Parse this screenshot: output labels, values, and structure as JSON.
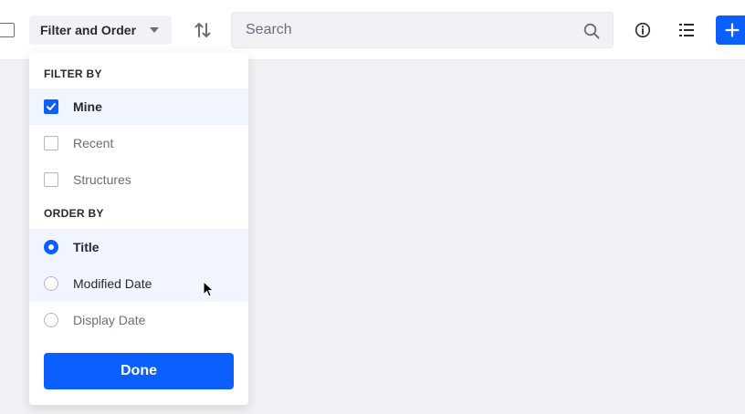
{
  "toolbar": {
    "filter_label": "Filter and Order",
    "search_placeholder": "Search",
    "accent": "#0b5fff"
  },
  "filter_menu": {
    "filter_header": "FILTER BY",
    "filter_items": [
      {
        "label": "Mine",
        "checked": true
      },
      {
        "label": "Recent",
        "checked": false
      },
      {
        "label": "Structures",
        "checked": false
      }
    ],
    "order_header": "ORDER BY",
    "order_items": [
      {
        "label": "Title",
        "selected": true
      },
      {
        "label": "Modified Date",
        "selected": false
      },
      {
        "label": "Display Date",
        "selected": false
      }
    ],
    "done_label": "Done"
  },
  "icons": {
    "sort": "sort-icon",
    "search": "search-icon",
    "info": "info-icon",
    "list": "list-icon",
    "add": "plus-icon"
  }
}
